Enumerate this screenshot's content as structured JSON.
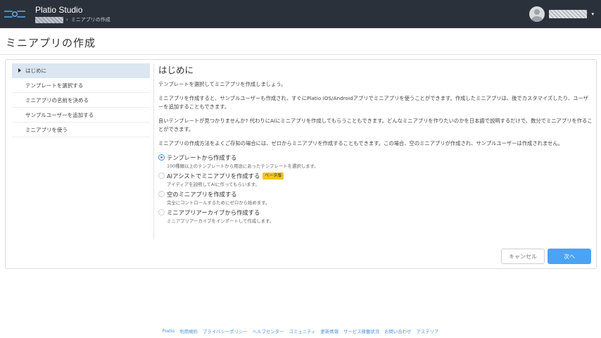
{
  "header": {
    "app_title": "Platio Studio",
    "breadcrumb_separator": "›",
    "breadcrumb_current": "ミニアプリの作成",
    "brand_color": "#2b313b",
    "logo_icon": "platio-logo-icon",
    "avatar_icon": "user-avatar-icon",
    "menu_icon": "caret-down-icon"
  },
  "page": {
    "title": "ミニアプリの作成"
  },
  "steps": [
    {
      "label": "はじめに",
      "active": true
    },
    {
      "label": "テンプレートを選択する",
      "active": false
    },
    {
      "label": "ミニアプリの名前を決める",
      "active": false
    },
    {
      "label": "サンプルユーザーを追加する",
      "active": false
    },
    {
      "label": "ミニアプリを使う",
      "active": false
    }
  ],
  "main": {
    "heading": "はじめに",
    "paragraphs": [
      "テンプレートを選択してミニアプリを作成しましょう。",
      "ミニアプリを作成すると、サンプルユーザーも作成され、すぐにPlatio iOS/Androidアプリでミニアプリを使うことができます。作成したミニアプリは、後でカスタマイズしたり、ユーザーを追加することもできます。",
      "良いテンプレートが見つかりませんか? 代わりにAIにミニアプリを作成してもらうこともできます。どんなミニアプリを作りたいのかを日本語で説明するだけで、数分でミニアプリを作ることができます。",
      "ミニアプリの作成方法をよくご存知の場合には、ゼロからミニアプリを作成することもできます。この場合、空のミニアプリが作成され、サンプルユーザーは作成されません。"
    ],
    "options": [
      {
        "label": "テンプレートから作成する",
        "description": "100種類以上のテンプレートから用途にあったテンプレートを選択します。",
        "selected": true
      },
      {
        "label": "AIアシストでミニアプリを作成する",
        "badge": "ベータ版",
        "description": "アイディアを説明してAIに作ってもらいます。",
        "selected": false
      },
      {
        "label": "空のミニアプリを作成する",
        "description": "完全にコントロールするためにゼロから始めます。",
        "selected": false
      },
      {
        "label": "ミニアプリアーカイブから作成する",
        "description": "ミニアプリアーカイブをインポートして作成します。",
        "selected": false
      }
    ],
    "accent_color": "#3a8ee6",
    "badge_color": "#f5c518"
  },
  "buttons": {
    "cancel": "キャンセル",
    "next": "次へ",
    "next_color": "#4ba3f5"
  },
  "footer": {
    "links": [
      "Platio",
      "利用規約",
      "プライバシーポリシー",
      "ヘルプセンター",
      "コミュニティ",
      "更新情報",
      "サービス稼働状況",
      "お問い合わせ",
      "アステリア"
    ]
  }
}
